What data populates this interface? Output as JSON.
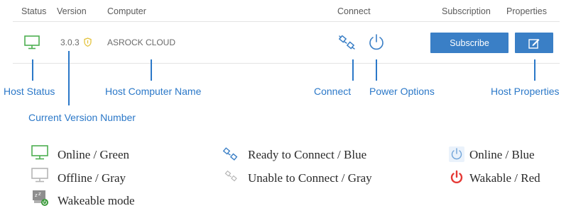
{
  "header": {
    "status": "Status",
    "version": "Version",
    "computer": "Computer",
    "connect": "Connect",
    "subscription": "Subscription",
    "properties": "Properties"
  },
  "row": {
    "version": "3.0.3",
    "computer_name": "ASROCK CLOUD",
    "subscribe_label": "Subscribe"
  },
  "callouts": {
    "host_status": "Host Status",
    "current_version": "Current Version Number",
    "host_computer_name": "Host Computer Name",
    "connect": "Connect",
    "power_options": "Power Options",
    "host_properties": "Host Properties"
  },
  "legend": {
    "online_green": "Online / Green",
    "offline_gray": "Offline / Gray",
    "wakeable_mode": "Wakeable mode",
    "ready_blue": "Ready to Connect / Blue",
    "unable_gray": "Unable to Connect / Gray",
    "online_blue": "Online / Blue",
    "wakable_red": "Wakable / Red"
  },
  "colors": {
    "accent_blue": "#3a7fc6",
    "callout_blue": "#2b78c8",
    "online_green": "#4caf50",
    "offline_gray": "#b5b5b5",
    "wakable_red": "#e53935",
    "version_badge": "#e3c23a"
  },
  "icons": {
    "status": "monitor-icon",
    "version_badge": "shield-icon",
    "connect": "plug-icon",
    "power": "power-icon",
    "properties": "edit-icon",
    "wakeable": "sleeping-monitor-icon"
  }
}
